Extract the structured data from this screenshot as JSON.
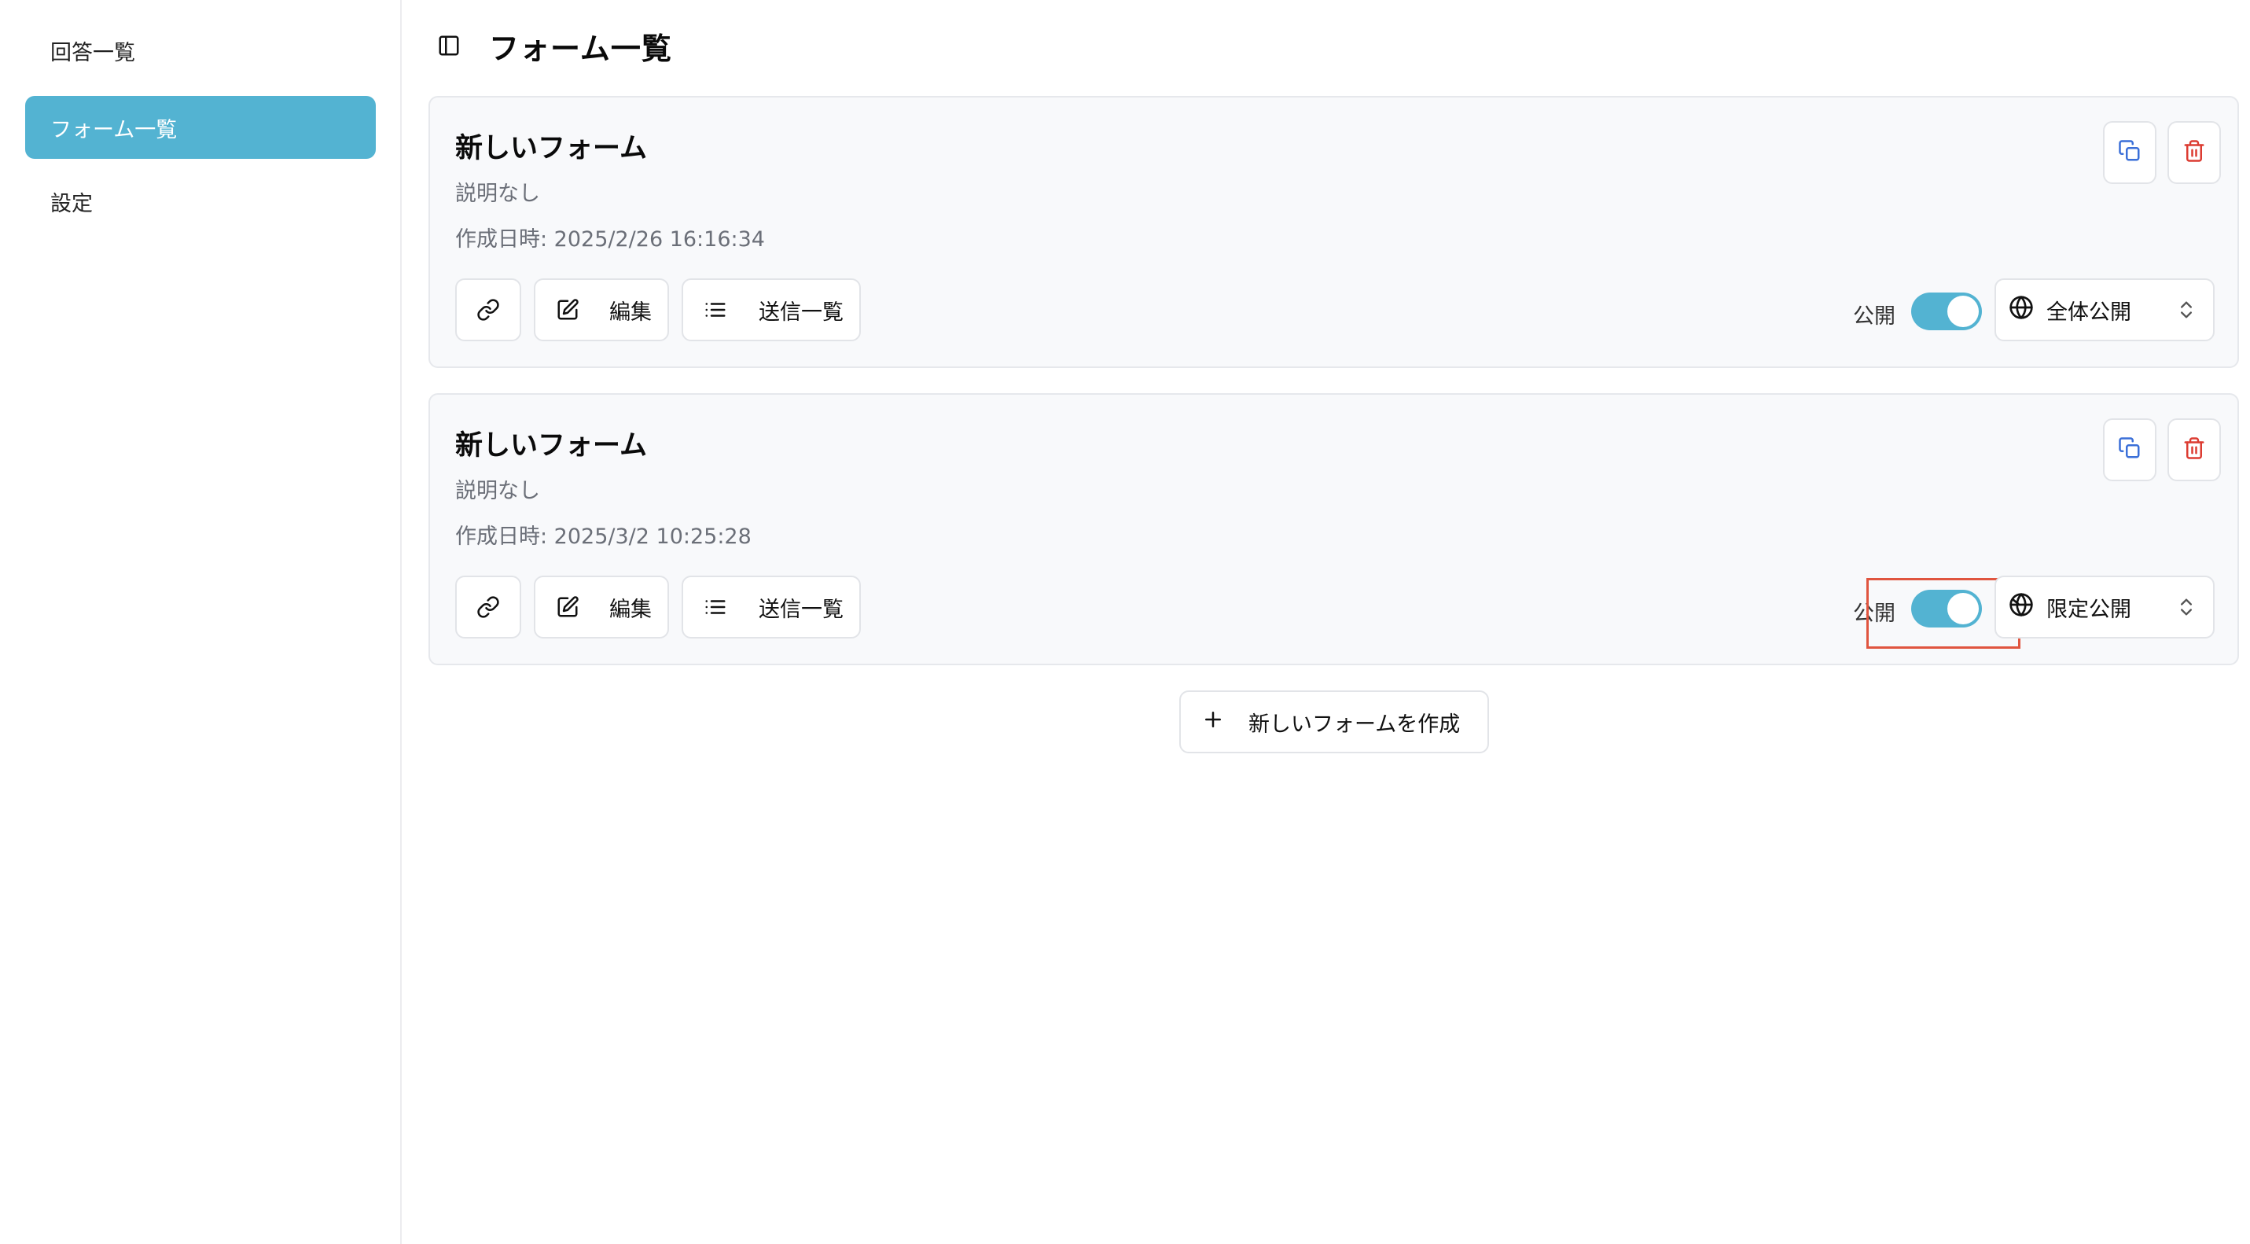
{
  "sidebar": {
    "items": [
      {
        "label": "回答一覧",
        "active": false
      },
      {
        "label": "フォーム一覧",
        "active": true
      },
      {
        "label": "設定",
        "active": false
      }
    ]
  },
  "header": {
    "toggle_icon": "sidebar-toggle-icon",
    "title": "フォーム一覧"
  },
  "forms": [
    {
      "title": "新しいフォーム",
      "description": "説明なし",
      "created": "作成日時: 2025/2/26 16:16:34",
      "edit_label": "編集",
      "list_label": "送信一覧",
      "public_label": "公開",
      "public_on": true,
      "visibility": "全体公開",
      "visibility_icon": "globe-icon"
    },
    {
      "title": "新しいフォーム",
      "description": "説明なし",
      "created": "作成日時: 2025/3/2 10:25:28",
      "edit_label": "編集",
      "list_label": "送信一覧",
      "public_label": "公開",
      "public_on": true,
      "visibility": "限定公開",
      "visibility_icon": "globe-lock-icon"
    }
  ],
  "create_button": {
    "label": "新しいフォームを作成"
  },
  "colors": {
    "accent": "#53b3d2",
    "delete": "#dc3c32",
    "copy": "#3a6fd8",
    "highlight": "#e0553f"
  }
}
